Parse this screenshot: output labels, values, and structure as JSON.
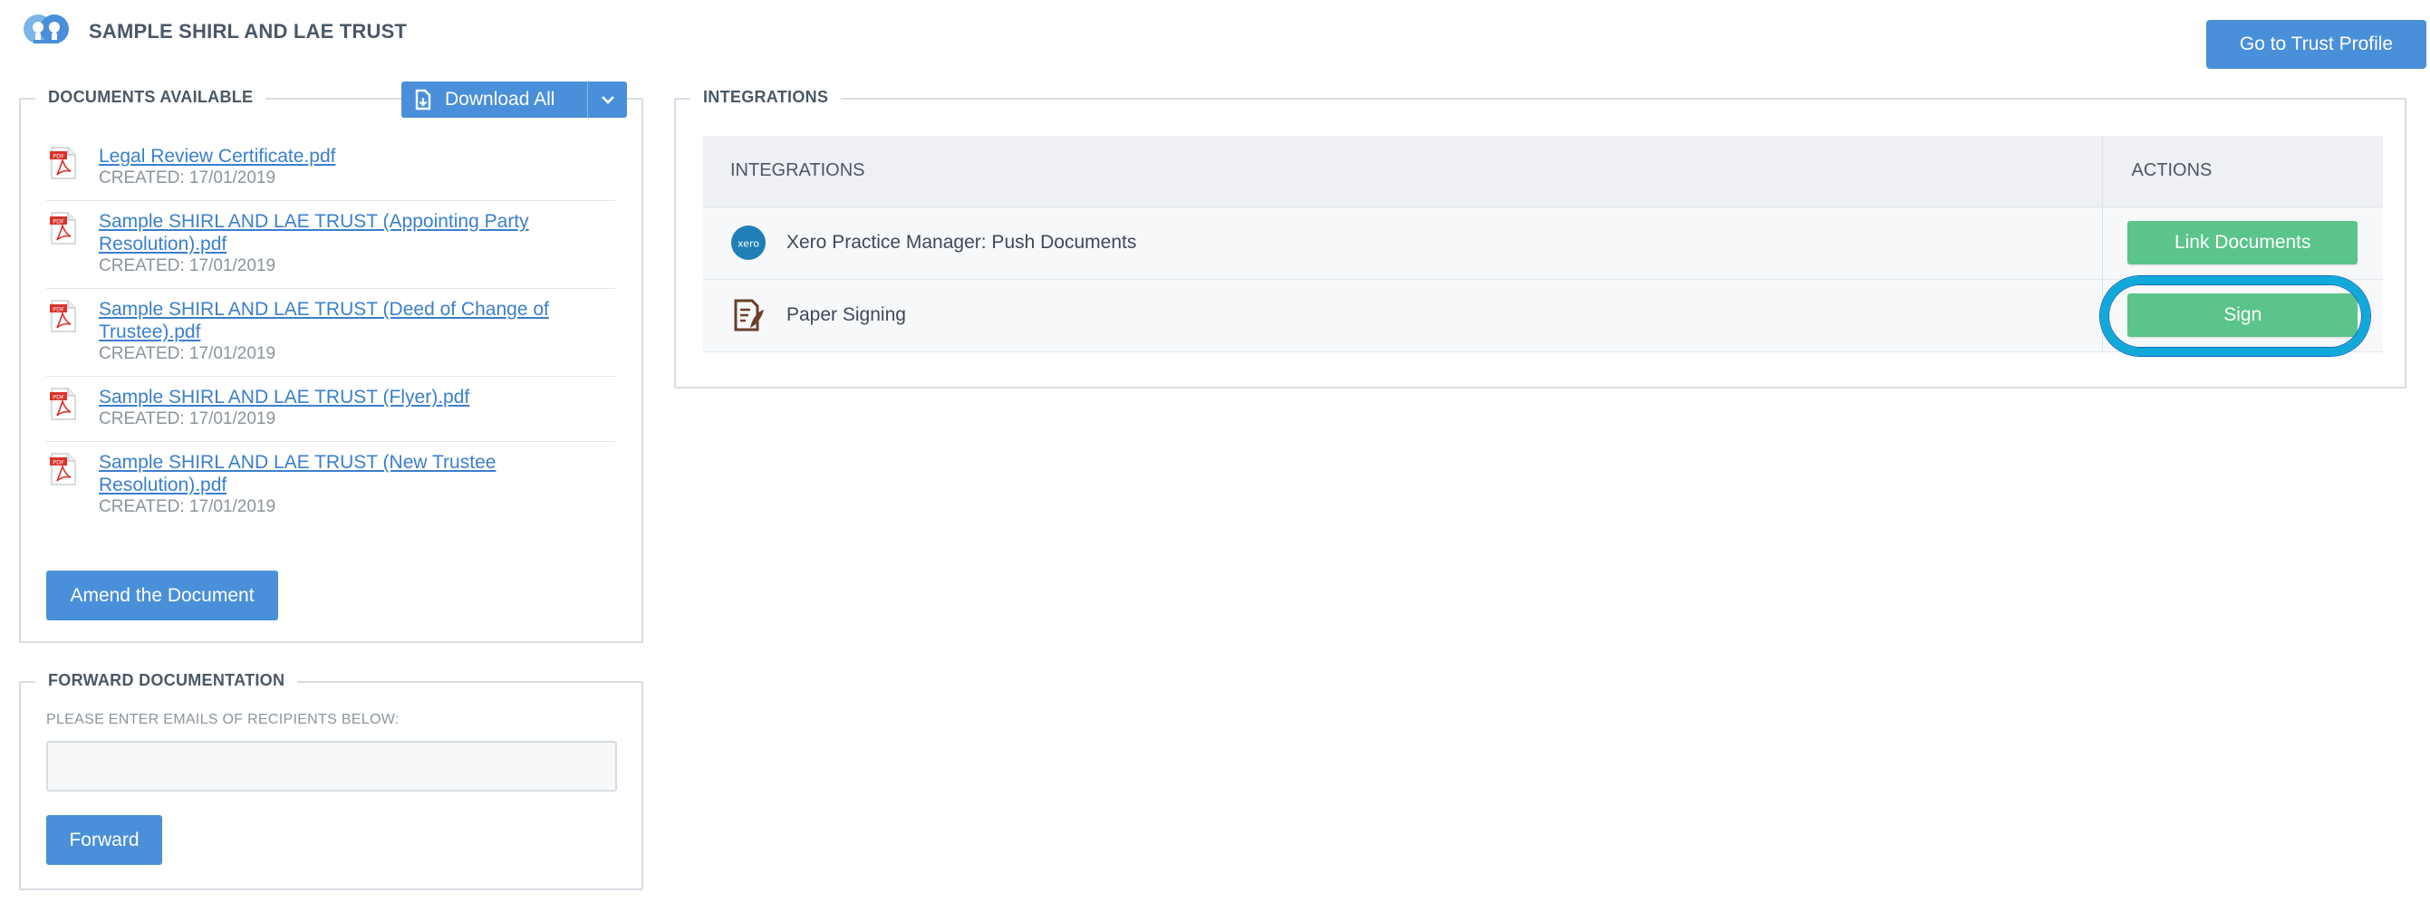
{
  "header": {
    "trust_name": "SAMPLE SHIRL AND LAE TRUST",
    "profile_button": "Go to Trust Profile"
  },
  "documents": {
    "legend": "DOCUMENTS AVAILABLE",
    "download_all": "Download All",
    "items": [
      {
        "name": "Legal Review Certificate.pdf",
        "created": "CREATED: 17/01/2019"
      },
      {
        "name": "Sample SHIRL AND LAE TRUST (Appointing Party Resolution).pdf",
        "created": "CREATED: 17/01/2019"
      },
      {
        "name": "Sample SHIRL AND LAE TRUST (Deed of Change of Trustee).pdf",
        "created": "CREATED: 17/01/2019"
      },
      {
        "name": "Sample SHIRL AND LAE TRUST (Flyer).pdf",
        "created": "CREATED: 17/01/2019"
      },
      {
        "name": "Sample SHIRL AND LAE TRUST (New Trustee Resolution).pdf",
        "created": "CREATED: 17/01/2019"
      }
    ],
    "amend_button": "Amend the Document"
  },
  "forward": {
    "legend": "FORWARD DOCUMENTATION",
    "label": "PLEASE ENTER EMAILS OF RECIPIENTS BELOW:",
    "input_value": "",
    "input_placeholder": "",
    "button": "Forward"
  },
  "integrations": {
    "legend": "INTEGRATIONS",
    "columns": [
      "INTEGRATIONS",
      "ACTIONS"
    ],
    "rows": [
      {
        "icon": "xero-icon",
        "icon_text": "xero",
        "name": "Xero Practice Manager: Push Documents",
        "action": "Link Documents"
      },
      {
        "icon": "paper-signing-icon",
        "name": "Paper Signing",
        "action": "Sign"
      }
    ]
  },
  "colors": {
    "primary": "#4a8fd9",
    "success": "#5ac48a",
    "highlight": "#11a9d8",
    "pdf_red": "#d9322b",
    "xero_blue": "#1f7fb6"
  }
}
